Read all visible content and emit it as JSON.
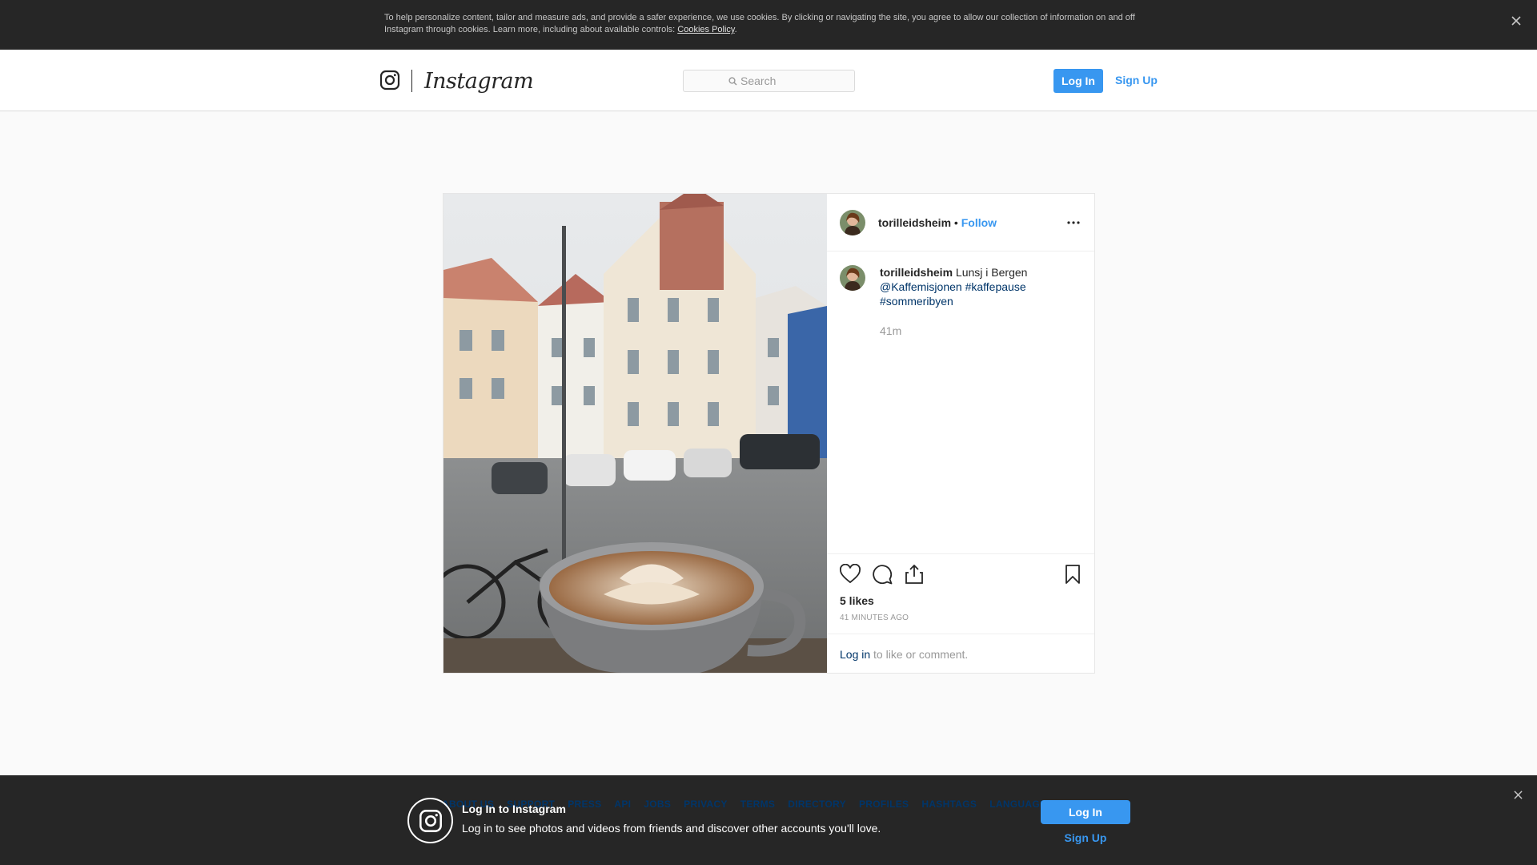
{
  "cookie_banner": {
    "text": "To help personalize content, tailor and measure ads, and provide a safer experience, we use cookies. By clicking or navigating the site, you agree to allow our collection of information on and off Instagram through cookies. Learn more, including about available controls: ",
    "link_label": "Cookies Policy",
    "trailing": "."
  },
  "nav": {
    "wordmark": "Instagram",
    "search_placeholder": "Search",
    "login_label": "Log In",
    "signup_label": "Sign Up"
  },
  "post": {
    "username": "torilleidsheim",
    "separator": " • ",
    "follow_label": "Follow",
    "caption_text": " Lunsj i Bergen",
    "caption_tags": [
      "@Kaffemisjonen",
      "#kaffepause",
      "#sommeribyen"
    ],
    "caption_time": "41m",
    "likes": "5 likes",
    "date": "41 MINUTES AGO",
    "login_link": "Log in",
    "login_suffix": " to like or comment."
  },
  "footer_links": [
    "ABOUT US",
    "SUPPORT",
    "PRESS",
    "API",
    "JOBS",
    "PRIVACY",
    "TERMS",
    "DIRECTORY",
    "PROFILES",
    "HASHTAGS",
    "LANGUAGE"
  ],
  "bottom_bar": {
    "title": "Log In to Instagram",
    "subtitle": "Log in to see photos and videos from friends and discover other accounts you'll love.",
    "login_label": "Log In",
    "signup_label": "Sign Up"
  },
  "icons": {
    "logo": "instagram-glyph-icon",
    "search": "search-icon",
    "close": "close-icon",
    "more": "more-options-icon",
    "like": "heart-icon",
    "comment": "comment-icon",
    "share": "share-icon",
    "save": "bookmark-icon"
  },
  "colors": {
    "accent": "#3897f0",
    "link_dark": "#003569",
    "banner_bg": "#262626"
  }
}
